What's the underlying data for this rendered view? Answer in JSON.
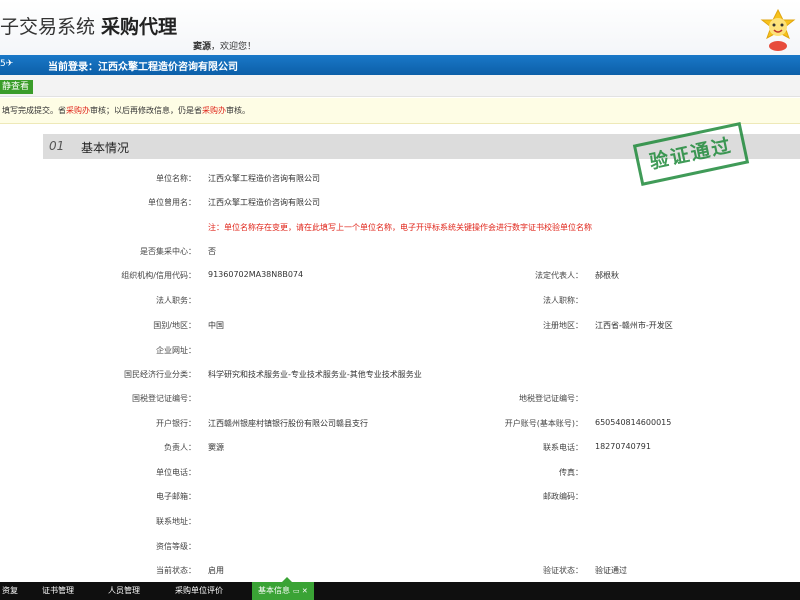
{
  "header": {
    "title": "子交易系统",
    "subtitle": "采购代理",
    "welcome_name": "窦源",
    "welcome_text": "，欢迎您！"
  },
  "bluebar": {
    "stub": "5✈",
    "login_label": "当前登录：",
    "login_company": "江西众擎工程造价咨询有限公司"
  },
  "toolbar": {
    "view_label": "静查看"
  },
  "notice": {
    "p1": "填写完成提交。省",
    "p1_red": "采购办",
    "p2": "审核；以后再修改信息，仍是省",
    "p2_red": "采购办",
    "p3": "审核。"
  },
  "section": {
    "number": "01",
    "title": "基本情况"
  },
  "stamp": {
    "text": "验证通过"
  },
  "warning": "注：单位名称存在变更，请在此填写上一个单位名称，电子开评标系统关键操作会进行数字证书校验单位名称",
  "fields_left": [
    {
      "label": "单位名称：",
      "value": "江西众擎工程造价咨询有限公司"
    },
    {
      "label": "单位曾用名：",
      "value": "江西众擎工程造价咨询有限公司"
    },
    {
      "label": "是否集采中心：",
      "value": "否"
    },
    {
      "label": "组织机构/信用代码：",
      "value": "91360702MA38N8B074"
    },
    {
      "label": "法人职务：",
      "value": ""
    },
    {
      "label": "国别/地区：",
      "value": "中国"
    },
    {
      "label": "企业网址：",
      "value": ""
    },
    {
      "label": "国民经济行业分类：",
      "value": "科学研究和技术服务业-专业技术服务业-其他专业技术服务业"
    },
    {
      "label": "国税登记证编号：",
      "value": ""
    },
    {
      "label": "开户银行：",
      "value": "江西赣州银座村镇银行股份有限公司赣县支行"
    },
    {
      "label": "负责人：",
      "value": "窦源"
    },
    {
      "label": "单位电话：",
      "value": ""
    },
    {
      "label": "电子邮箱：",
      "value": ""
    },
    {
      "label": "联系地址：",
      "value": ""
    },
    {
      "label": "资信等级：",
      "value": ""
    },
    {
      "label": "当前状态：",
      "value": "启用"
    }
  ],
  "fields_right": [
    {
      "label": "法定代表人：",
      "value": "郝根秋"
    },
    {
      "label": "法人职称：",
      "value": ""
    },
    {
      "label": "注册地区：",
      "value": "江西省-赣州市-开发区"
    },
    {
      "label": "地税登记证编号：",
      "value": ""
    },
    {
      "label": "开户账号(基本账号)：",
      "value": "650540814600015"
    },
    {
      "label": "联系电话：",
      "value": "18270740791"
    },
    {
      "label": "传真：",
      "value": ""
    },
    {
      "label": "邮政编码：",
      "value": ""
    },
    {
      "label": "验证状态：",
      "value": "验证通过"
    }
  ],
  "bottom_tabs": [
    {
      "label": "资复"
    },
    {
      "label": "证书管理"
    },
    {
      "label": "人员管理"
    },
    {
      "label": "采购单位评价"
    },
    {
      "label": "基本信息",
      "extra": "▭ ✕"
    }
  ]
}
